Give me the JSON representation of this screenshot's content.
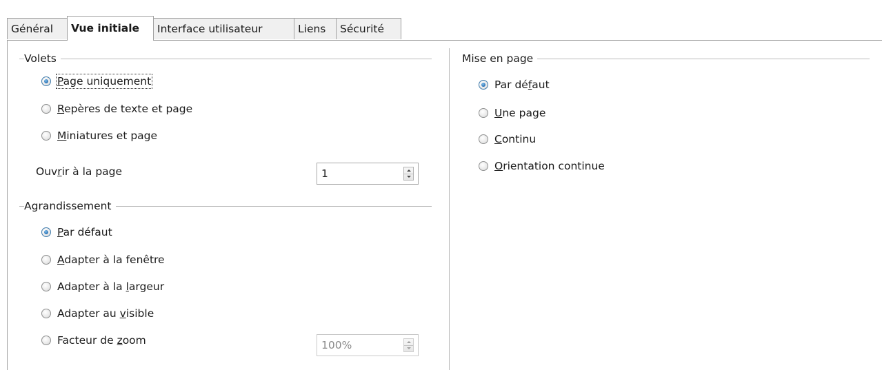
{
  "tabs": [
    {
      "label": "Général",
      "active": false
    },
    {
      "label": "Vue initiale",
      "active": true
    },
    {
      "label": "Interface utilisateur",
      "active": false
    },
    {
      "label": "Liens",
      "active": false
    },
    {
      "label": "Sécurité",
      "active": false
    }
  ],
  "volets": {
    "title": "Volets",
    "options": [
      {
        "pre": "",
        "u": "P",
        "post": "age uniquement",
        "checked": true
      },
      {
        "pre": "",
        "u": "R",
        "post": "epères de texte et page",
        "checked": false
      },
      {
        "pre": "",
        "u": "M",
        "post": "iniatures et page",
        "checked": false
      }
    ],
    "open_page_label": {
      "pre": "Ouv",
      "u": "r",
      "post": "ir à la page"
    },
    "open_page_value": "1"
  },
  "agrandissement": {
    "title": "Agrandissement",
    "options": [
      {
        "pre": "",
        "u": "P",
        "post": "ar défaut",
        "checked": true
      },
      {
        "pre": "",
        "u": "A",
        "post": "dapter à la fenêtre",
        "checked": false
      },
      {
        "pre": "Adapter à la ",
        "u": "l",
        "post": "argeur",
        "checked": false
      },
      {
        "pre": "Adapter au ",
        "u": "v",
        "post": "isible",
        "checked": false
      },
      {
        "pre": "Facteur de ",
        "u": "z",
        "post": "oom",
        "checked": false
      }
    ],
    "zoom_value": "100%"
  },
  "mise_en_page": {
    "title": "Mise en page",
    "options": [
      {
        "pre": "Par dé",
        "u": "f",
        "post": "aut",
        "checked": true
      },
      {
        "pre": "",
        "u": "U",
        "post": "ne page",
        "checked": false
      },
      {
        "pre": "",
        "u": "C",
        "post": "ontinu",
        "checked": false
      },
      {
        "pre": "",
        "u": "O",
        "post": "rientation continue",
        "checked": false
      }
    ]
  }
}
